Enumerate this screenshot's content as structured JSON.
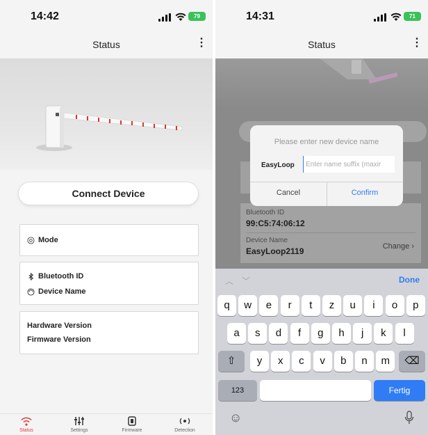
{
  "left_screen": {
    "status_bar": {
      "time": "14:42",
      "battery": "79"
    },
    "nav": {
      "title": "Status",
      "more": "⋮"
    },
    "connect_button": "Connect Device",
    "mode_card": {
      "mode_label": "Mode"
    },
    "bluetooth_card": {
      "bluetooth_label": "Bluetooth ID",
      "device_name_label": "Device Name"
    },
    "version_card": {
      "hardware_label": "Hardware Version",
      "firmware_label": "Firmware Version"
    },
    "tabs": [
      {
        "label": "Status",
        "icon": "wifi-signal-icon",
        "active": true
      },
      {
        "label": "Settings",
        "icon": "sliders-icon",
        "active": false
      },
      {
        "label": "Firmware",
        "icon": "chip-icon",
        "active": false
      },
      {
        "label": "Detection",
        "icon": "radar-icon",
        "active": false
      }
    ],
    "colors": {
      "active_tab": "#e23b3b"
    }
  },
  "right_screen": {
    "status_bar": {
      "time": "14:31",
      "battery": "71"
    },
    "nav": {
      "title": "Status",
      "more": "⋮"
    },
    "info": {
      "bluetooth_label": "Bluetooth ID",
      "bluetooth_value": "99:C5:74:06:12",
      "device_name_label": "Device Name",
      "device_name_value": "EasyLoop2119",
      "change_label": "Change"
    },
    "dialog": {
      "title": "Please enter new device name",
      "prefix": "EasyLoop",
      "input_placeholder": "Enter name suffix (maxir",
      "input_value": "",
      "cancel_label": "Cancel",
      "confirm_label": "Confirm"
    },
    "keyboard": {
      "done_label": "Done",
      "row1": [
        "q",
        "w",
        "e",
        "r",
        "t",
        "z",
        "u",
        "i",
        "o",
        "p"
      ],
      "row2": [
        "a",
        "s",
        "d",
        "f",
        "g",
        "h",
        "j",
        "k",
        "l"
      ],
      "row3": [
        "y",
        "x",
        "c",
        "v",
        "b",
        "n",
        "m"
      ],
      "numbers_key": "123",
      "return_key": "Fertig"
    },
    "colors": {
      "accent": "#2f7cf6"
    }
  }
}
